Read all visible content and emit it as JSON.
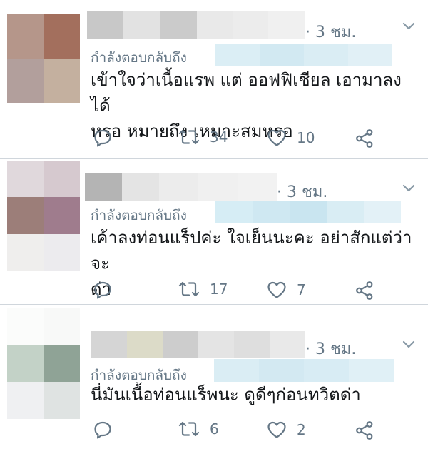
{
  "reply_prefix": "กำลังตอบกลับถึง",
  "tweets": [
    {
      "time": "· 3 ชม.",
      "text": "เข้าใจว่าเนื้อแรพ แต่ ออฟฟิเชียล เอามาลงได้\nหรอ หมายถึง เหมาะสมหรอ",
      "retweets": "34",
      "likes": "10",
      "avatar_colors": [
        "#b5968a",
        "#a36f5d",
        "#b29f9c",
        "#c4b09f"
      ]
    },
    {
      "time": "· 3 ชม.",
      "text": "เค้าลงท่อนแร็ปค่ะ ใจเย็นนะคะ อย่าสักแต่ว่าจะ\nด่า",
      "retweets": "17",
      "likes": "7",
      "avatar_colors": [
        "#e0d8dc",
        "#d6c9cf",
        "#9c7e79",
        "#9f7c8d",
        "#efeeed",
        "#ecebee"
      ]
    },
    {
      "time": "· 3 ชม.",
      "text": "นี่มันเนื้อท่อนแร็พนะ ดูดีๆก่อนทวิตด่า",
      "retweets": "6",
      "likes": "2",
      "avatar_colors": [
        "#fbfcfb",
        "#f8f9f8",
        "#c3d2c7",
        "#8fa396",
        "#eff0f2",
        "#dfe3e2"
      ]
    }
  ],
  "colors": {
    "meta": "#657786",
    "text": "#14171a",
    "divider": "#d0d6dc",
    "blur_handle": "#d7ebf3"
  },
  "icons": [
    "reply-icon",
    "retweet-icon",
    "like-icon",
    "share-icon",
    "chevron-down-icon"
  ]
}
